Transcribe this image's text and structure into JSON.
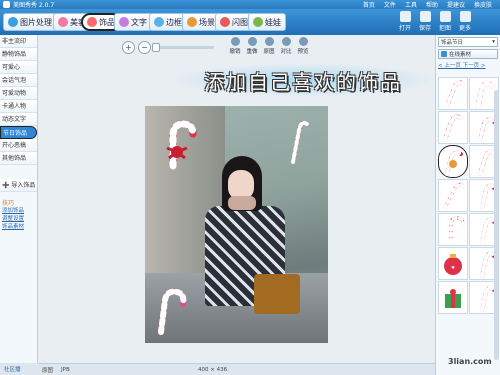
{
  "titlebar": {
    "app_title": "美图秀秀 2.0.7",
    "menu": [
      "首页",
      "文件",
      "工具",
      "帮助",
      "提建议",
      "换皮肤"
    ]
  },
  "tabs": [
    {
      "label": "图片处理",
      "icon": "picture-icon",
      "color": "#3aa0e0"
    },
    {
      "label": "美容",
      "icon": "face-icon",
      "color": "#f07aa0"
    },
    {
      "label": "饰品",
      "icon": "heart-icon",
      "color": "#ff6a6a"
    },
    {
      "label": "文字",
      "icon": "text-icon",
      "color": "#c47be0"
    },
    {
      "label": "边框",
      "icon": "frame-icon",
      "color": "#5ab0e8"
    },
    {
      "label": "场景",
      "icon": "scene-icon",
      "color": "#e89a3a"
    },
    {
      "label": "闪图",
      "icon": "flash-icon",
      "color": "#e85a5a"
    },
    {
      "label": "娃娃",
      "icon": "doll-icon",
      "color": "#7ab84a"
    }
  ],
  "toolbar_buttons": [
    {
      "label": "打开",
      "icon": "open-icon"
    },
    {
      "label": "保存",
      "icon": "save-icon"
    },
    {
      "label": "拒图",
      "icon": "crop-icon"
    },
    {
      "label": "更多",
      "icon": "more-icon"
    }
  ],
  "left_panel": {
    "items": [
      "非主流印",
      "静物饰品",
      "可爱心",
      "会话气泡",
      "可爱动物",
      "卡通人物",
      "动态文字",
      "节日饰品",
      "开心恶搞",
      "其他饰品"
    ],
    "active_index": 7,
    "import_label": "导入饰品",
    "tips_title": "技巧",
    "tips": [
      "添加饰品",
      "调整设置",
      "饰品素材"
    ],
    "footer": "社区播"
  },
  "canvas": {
    "zoom_in": "+",
    "zoom_out": "−",
    "ops": [
      "撤销",
      "重做",
      "原图",
      "对比",
      "预览"
    ],
    "banner_text": "添加自己喜欢的饰品",
    "status_label": "原图",
    "file_ext": "JPB",
    "image_size": "400 × 436"
  },
  "right_panel": {
    "dropdown_value": "饰品节日",
    "online_button": "在线素材",
    "pager": "< 上一页 下一页 >"
  },
  "watermark": "3lian.com",
  "colors": {
    "toolbar_blue": "#2a7bc0",
    "active_item": "#2f86d6",
    "cane_red": "#e0304a"
  }
}
